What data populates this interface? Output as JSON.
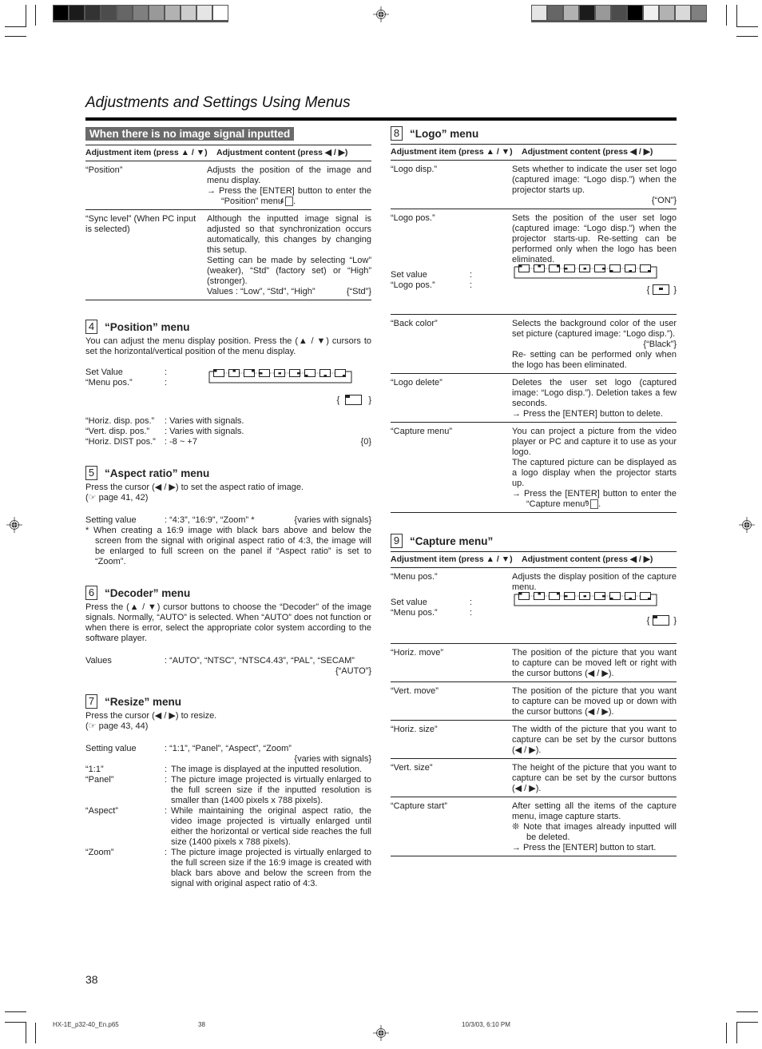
{
  "page_title": "Adjustments and Settings Using Menus",
  "page_number": "38",
  "colorbar_left": [
    "#000000",
    "#1b1b1b",
    "#333333",
    "#4c4c4c",
    "#666666",
    "#7f7f7f",
    "#999999",
    "#b2b2b2",
    "#cccccc",
    "#e5e5e5",
    "#ffffff"
  ],
  "colorbar_right": [
    "#e5e5e5",
    "#666666",
    "#b2b2b2",
    "#1b1b1b",
    "#999999",
    "#4c4c4c",
    "#000000",
    "#f0f0f0",
    "#b2b2b2",
    "#d9d9d9",
    "#808080"
  ],
  "no_signal": {
    "banner": "When there is no image signal inputted",
    "head_item": "Adjustment item (press ▲ / ▼)",
    "head_content": "Adjustment content (press ◀ / ▶)",
    "rows": [
      {
        "item": "“Position”",
        "content": "Adjusts the position of the image and menu display.",
        "note": "→ Press the [ENTER] button to enter the “Position” menu",
        "ref": "4"
      },
      {
        "item": "“Sync level” (When PC input is selected)",
        "content": "Although the inputted image signal is adjusted so that synchronization occurs automatically, this changes by changing this setup.",
        "content2": "Setting can be made by selecting “Low” (weaker), “Std” (factory set) or “High” (stronger).",
        "values": "Values : “Low”, “Std”, “High”",
        "default": "{“Std”}"
      }
    ]
  },
  "position_menu": {
    "num": "4",
    "title": "“Position” menu",
    "desc": "You can adjust the menu display position. Press the (▲ / ▼) cursors to set the horizontal/vertical position of the menu display.",
    "set_value_label": "Set Value",
    "menu_pos_label": "“Menu pos.”",
    "colon": ":",
    "default_brace_l": "{",
    "default_brace_r": "}",
    "items": [
      {
        "k": "“Horiz. disp. pos.”",
        "v": ": Varies with signals.",
        "d": ""
      },
      {
        "k": "“Vert. disp. pos.”",
        "v": ": Varies with signals.",
        "d": ""
      },
      {
        "k": "“Horiz. DIST pos.”",
        "v": ": -8 ~ +7",
        "d": "{0}"
      }
    ]
  },
  "aspect_menu": {
    "num": "5",
    "title": "“Aspect ratio” menu",
    "desc": "Press the cursor (◀ / ▶) to set the aspect ratio of image.",
    "ref": "(☞ page 41, 42)",
    "setting_label": "Setting value",
    "setting_value": ": “4:3”, “16:9”, “Zoom” *",
    "setting_default": "{varies with signals}",
    "footnote": "* When creating a 16:9 image with black bars above and below the screen from the signal with original aspect ratio of 4:3, the image will be enlarged to full screen on the panel if “Aspect ratio” is set to “Zoom”."
  },
  "decoder_menu": {
    "num": "6",
    "title": "“Decoder” menu",
    "desc": "Press the (▲ / ▼) cursor buttons to choose the “Decoder” of the image signals. Normally, “AUTO” is selected. When “AUTO” does not function or when there is error, select the appropriate color system according to the software player.",
    "values_label": "Values",
    "values": ": “AUTO”, “NTSC”, “NTSC4.43”, “PAL”, “SECAM”",
    "default": "{“AUTO”}"
  },
  "resize_menu": {
    "num": "7",
    "title": "“Resize” menu",
    "desc": "Press the cursor (◀ / ▶) to resize.",
    "ref": "(☞ page 43, 44)",
    "setting_label": "Setting value",
    "setting_value": ": “1:1”, “Panel”, “Aspect”, “Zoom”",
    "setting_default": "{varies with signals}",
    "items": [
      {
        "k": "“1:1”",
        "v": "The image is displayed at the inputted resolution."
      },
      {
        "k": "“Panel”",
        "v": "The picture image projected is virtually enlarged to the full screen size if the inputted resolution is smaller than (1400 pixels x 788 pixels)."
      },
      {
        "k": "“Aspect”",
        "v": "While maintaining the original aspect ratio, the video image projected is virtually enlarged until either the horizontal or vertical side reaches the full size (1400 pixels x 788 pixels)."
      },
      {
        "k": "“Zoom”",
        "v": "The picture image projected is virtually enlarged to the full screen size if the 16:9 image is created with black bars above and below the screen from the signal with original aspect ratio of 4:3."
      }
    ]
  },
  "logo_menu": {
    "num": "8",
    "title": "“Logo” menu",
    "head_item": "Adjustment item (press ▲ / ▼)",
    "head_content": "Adjustment content (press ◀ / ▶)",
    "rows": [
      {
        "item": "“Logo disp.”",
        "content": "Sets whether to indicate the user set logo (captured image: “Logo disp.”) when the projector starts up.",
        "default": "{“ON”}"
      },
      {
        "item": "“Logo pos.”",
        "content": "Sets the position of the user set logo (captured image: “Logo disp.”) when the projector starts-up. Re-setting can be performed only when the logo has been eliminated.",
        "set_label": "Set value",
        "pos_label": "“Logo pos.”"
      },
      {
        "item": "“Back color”",
        "content": "Selects the background color of the user set picture (captured image: “Logo disp.”).",
        "default": "{“Black”}",
        "content2": "Re- setting can be performed only when the logo has been eliminated."
      },
      {
        "item": "“Logo delete”",
        "content": "Deletes the user set logo (captured image: “Logo disp.”). Deletion takes a few seconds.",
        "note": "→ Press the [ENTER] button to delete."
      },
      {
        "item": "“Capture menu”",
        "content": "You can project a picture from the video player or PC and capture it to use as your logo.",
        "content2": "The captured picture can be displayed as a logo display when the projector starts up.",
        "note": "→ Press the [ENTER] button to enter the “Capture menu”",
        "ref": "9"
      }
    ]
  },
  "capture_menu": {
    "num": "9",
    "title": "“Capture menu”",
    "head_item": "Adjustment item (press ▲ / ▼)",
    "head_content": "Adjustment content (press ◀ / ▶)",
    "rows": [
      {
        "item": "“Menu pos.”",
        "content": "Adjusts the display position of the capture menu.",
        "set_label": "Set value",
        "pos_label": "“Menu pos.”"
      },
      {
        "item": "“Horiz. move”",
        "content": "The position of the picture that you want to capture can be moved left or right with the cursor buttons (◀ / ▶)."
      },
      {
        "item": "“Vert. move”",
        "content": "The position of the picture that you want to capture can be moved up or down with the cursor buttons (◀ / ▶)."
      },
      {
        "item": "“Horiz. size”",
        "content": "The width of the picture that you want to capture can be set by the cursor buttons (◀ / ▶)."
      },
      {
        "item": "“Vert. size”",
        "content": "The height of the picture that you want to capture can be set by the cursor buttons (◀ / ▶)."
      },
      {
        "item": "“Capture start”",
        "content": "After setting all the items of the capture menu, image capture starts.",
        "note_star": "❊ Note that images already inputted will be deleted.",
        "note": "→ Press the [ENTER] button to start."
      }
    ]
  },
  "footer": {
    "file": "HX-1E_p32-40_En.p65",
    "page": "38",
    "timestamp": "10/3/03, 6:10 PM"
  }
}
